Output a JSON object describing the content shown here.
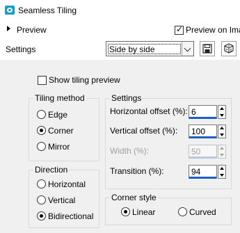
{
  "window": {
    "title": "Seamless Tiling",
    "icon": "camera-icon"
  },
  "preview": {
    "label": "Preview",
    "preview_on_image_label": "Preview on Ima",
    "preview_on_image_checked": true
  },
  "settings": {
    "label": "Settings",
    "preset_value": "Side by side",
    "save_icon": "save-icon",
    "random_icon": "dice-icon"
  },
  "show_tiling_preview": {
    "label": "Show tiling preview",
    "checked": false
  },
  "tiling_method": {
    "title": "Tiling method",
    "options": [
      {
        "label": "Edge",
        "selected": false
      },
      {
        "label": "Corner",
        "selected": true
      },
      {
        "label": "Mirror",
        "selected": false
      }
    ]
  },
  "direction": {
    "title": "Direction",
    "options": [
      {
        "label": "Horizontal",
        "selected": false
      },
      {
        "label": "Vertical",
        "selected": false
      },
      {
        "label": "Bidirectional",
        "selected": true
      }
    ]
  },
  "settings_group": {
    "title": "Settings",
    "horizontal_offset": {
      "label": "Horizontal offset (%):",
      "value": "6"
    },
    "vertical_offset": {
      "label": "Vertical offset (%):",
      "value": "100"
    },
    "width": {
      "label": "Width (%):",
      "value": "50",
      "disabled": true
    },
    "transition": {
      "label": "Transition (%):",
      "value": "94"
    }
  },
  "corner_style": {
    "title": "Corner style",
    "options": [
      {
        "label": "Linear",
        "selected": true
      },
      {
        "label": "Curved",
        "selected": false
      }
    ]
  },
  "colors": {
    "accent": "#1e5fc6",
    "panel_bg": "#f0f0f0",
    "icon_teal": "#1aa0c8"
  }
}
